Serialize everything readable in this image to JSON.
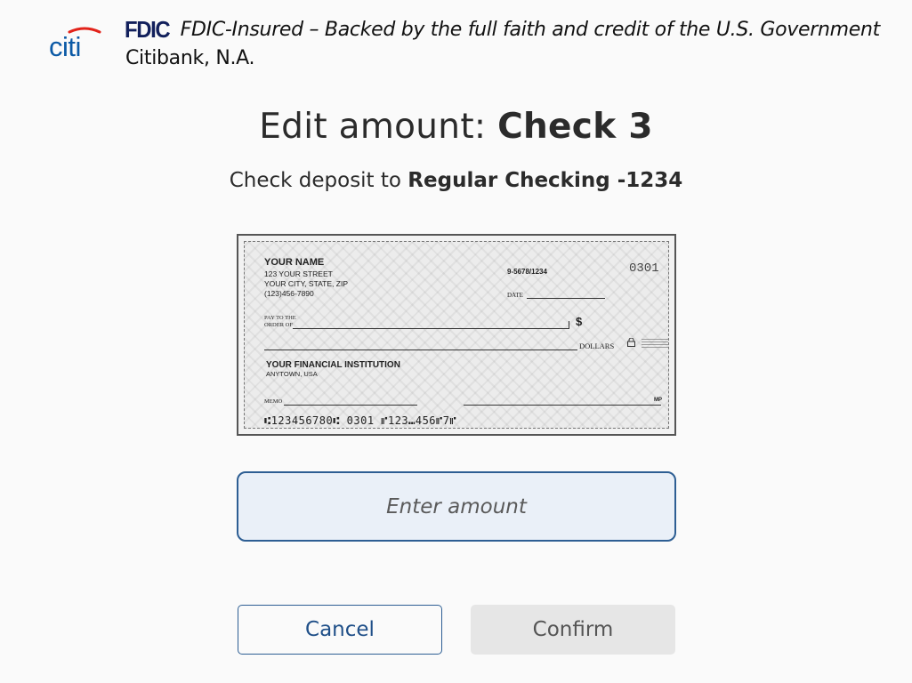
{
  "header": {
    "logo_text": "citi",
    "fdic_mark": "FDIC",
    "fdic_text": "FDIC-Insured – Backed by the full faith and credit of the U.S. Government",
    "bank_name": "Citibank, N.A."
  },
  "title": {
    "prefix": "Edit amount: ",
    "check_label": "Check 3"
  },
  "subtitle": {
    "prefix": "Check deposit to ",
    "account": "Regular Checking -1234"
  },
  "check_image": {
    "name": "YOUR NAME",
    "address_lines": [
      "123 YOUR STREET",
      "YOUR CITY, STATE, ZIP",
      "(123)456-7890"
    ],
    "routing_fraction": "9-5678/1234",
    "check_number": "0301",
    "date_label": "DATE",
    "pay_to_label_1": "PAY TO THE",
    "pay_to_label_2": "ORDER OF",
    "dollar_sign": "$",
    "dollars_label": "DOLLARS",
    "bank_name": "YOUR FINANCIAL INSTITUTION",
    "bank_city": "ANYTOWN, USA",
    "memo_label": "MEMO",
    "mp_label": "MP",
    "micr_line": "⑆123456780⑆ 0301 ⑈123⑉456⑈7⑈"
  },
  "amount_input": {
    "value": "",
    "placeholder": "Enter amount"
  },
  "buttons": {
    "cancel_label": "Cancel",
    "confirm_label": "Confirm"
  },
  "colors": {
    "citi_blue": "#0c5aa6",
    "citi_red": "#e2231a",
    "fdic_navy": "#12205c",
    "accent_blue": "#2d5e93",
    "input_bg": "#eaf0f8",
    "confirm_disabled_bg": "#e6e6e6"
  }
}
